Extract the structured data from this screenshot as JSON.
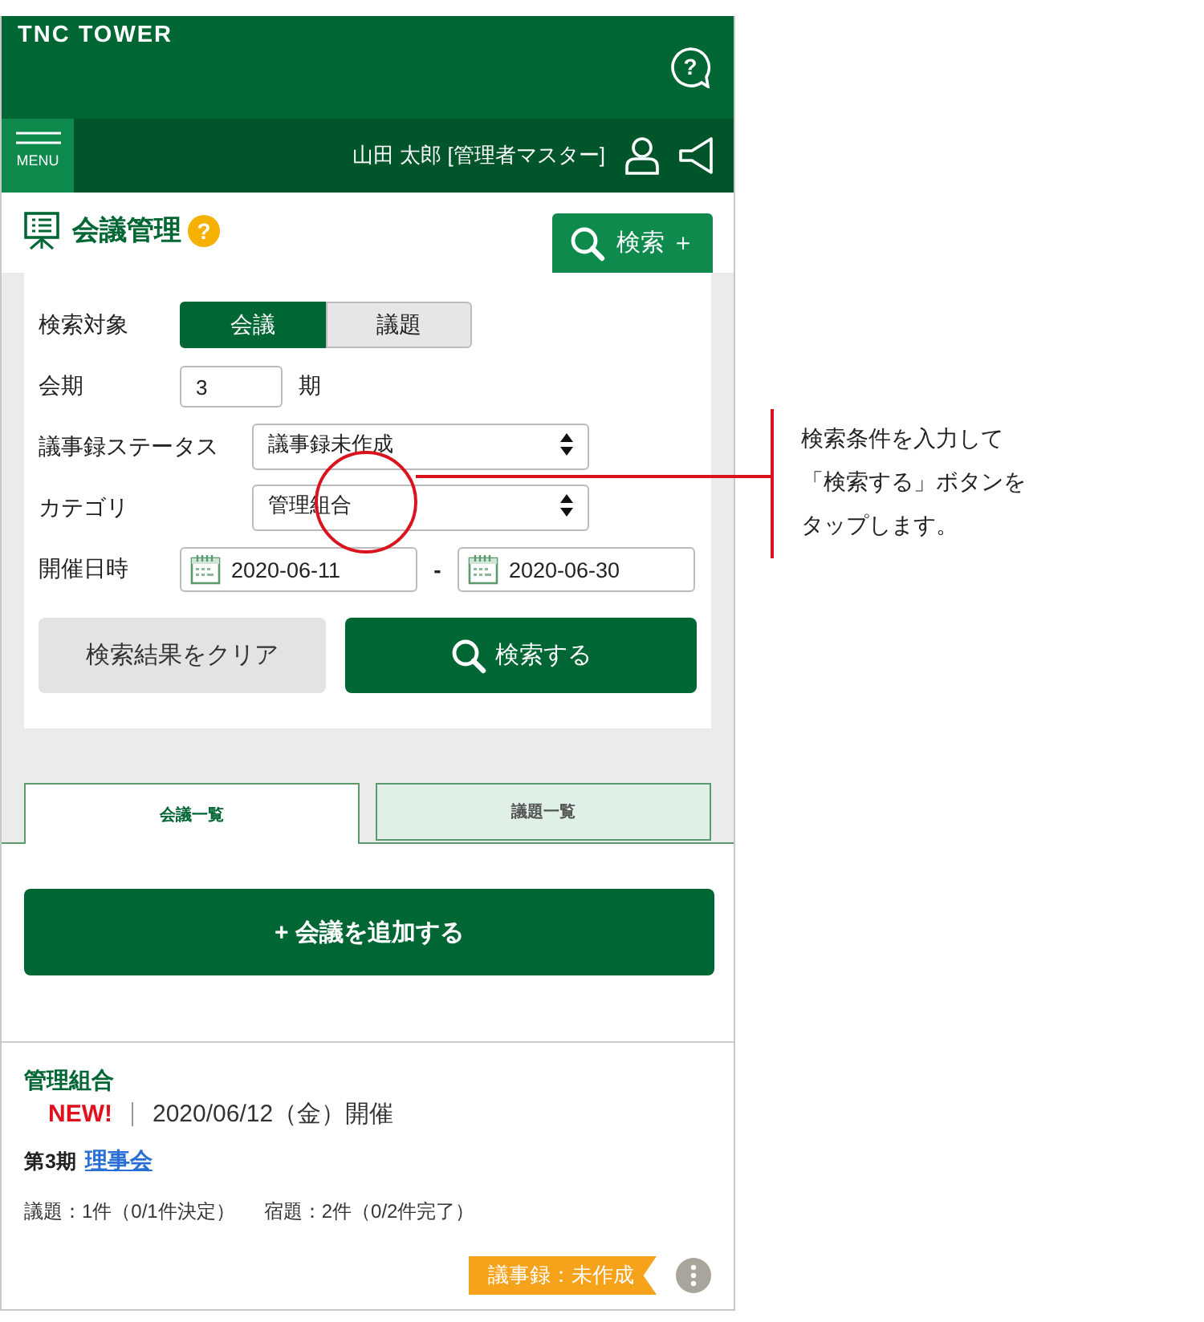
{
  "header": {
    "brand": "TNC TOWER",
    "help_glyph": "?",
    "menu_label": "MENU",
    "user": "山田 太郎 [管理者マスター]"
  },
  "page": {
    "title": "会議管理",
    "help_glyph": "?",
    "search_toggle": "検索 ＋"
  },
  "search_form": {
    "target": {
      "label": "検索対象",
      "options": [
        {
          "label": "会議",
          "selected": true
        },
        {
          "label": "議題",
          "selected": false
        }
      ]
    },
    "term": {
      "label": "会期",
      "value": "3",
      "unit": "期"
    },
    "status": {
      "label": "議事録ステータス",
      "value": "議事録未作成"
    },
    "category": {
      "label": "カテゴリ",
      "value": "管理組合"
    },
    "date": {
      "label": "開催日時",
      "from": "2020-06-11",
      "separator": "-",
      "to": "2020-06-30"
    },
    "buttons": [
      {
        "label": "検索結果をクリア",
        "kind": "secondary"
      },
      {
        "label": "検索する",
        "kind": "primary"
      }
    ]
  },
  "tabs": [
    {
      "label": "会議一覧",
      "selected": true
    },
    {
      "label": "議題一覧",
      "selected": false
    }
  ],
  "add_button": "+ 会議を追加する",
  "meetings": [
    {
      "category": "管理組合",
      "new_badge": "NEW!",
      "date": "2020/06/12（金）開催",
      "term": "第3期",
      "name": "理事会",
      "agenda": "議題：1件（0/1件決定）",
      "homework": "宿題：2件（0/2件完了）",
      "minutes_status": "議事録：未作成"
    }
  ],
  "callout": {
    "lines": [
      "検索条件を入力して",
      "「検索する」ボタンを",
      "タップします。"
    ]
  }
}
